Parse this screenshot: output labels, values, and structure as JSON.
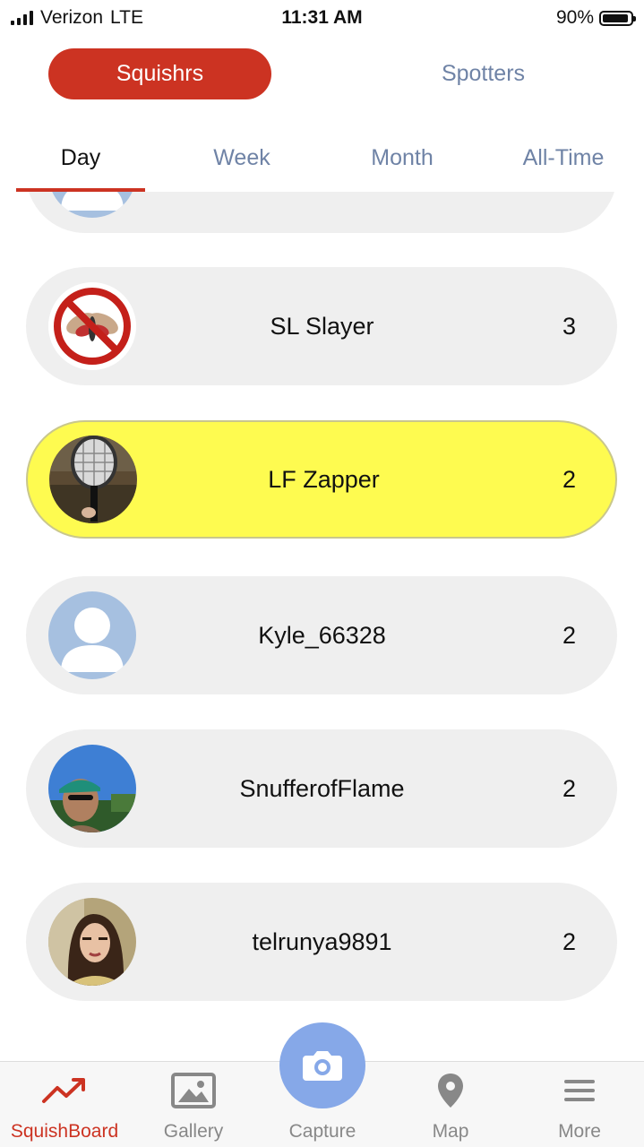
{
  "status_bar": {
    "carrier": "Verizon",
    "network": "LTE",
    "time": "11:31 AM",
    "battery": "90%"
  },
  "segments": {
    "active": "Squishrs",
    "inactive": "Spotters"
  },
  "period_tabs": [
    "Day",
    "Week",
    "Month",
    "All-Time"
  ],
  "active_period": "Day",
  "leaderboard": [
    {
      "name": "SL Slayer",
      "score": "3",
      "avatar": "no-lanternfly-icon"
    },
    {
      "name": "LF Zapper",
      "score": "2",
      "avatar": "bug-zapper-photo",
      "highlighted": true
    },
    {
      "name": "Kyle_66328",
      "score": "2",
      "avatar": "default-user-icon"
    },
    {
      "name": "SnufferofFlame",
      "score": "2",
      "avatar": "user-photo"
    },
    {
      "name": "telrunya9891",
      "score": "2",
      "avatar": "user-photo"
    }
  ],
  "tab_bar": {
    "squishboard": "SquishBoard",
    "gallery": "Gallery",
    "capture": "Capture",
    "map": "Map",
    "more": "More"
  },
  "colors": {
    "accent": "#cc3322",
    "inactive_text": "#6f83a6",
    "highlight": "#fefb50",
    "capture": "#86a8e8"
  }
}
